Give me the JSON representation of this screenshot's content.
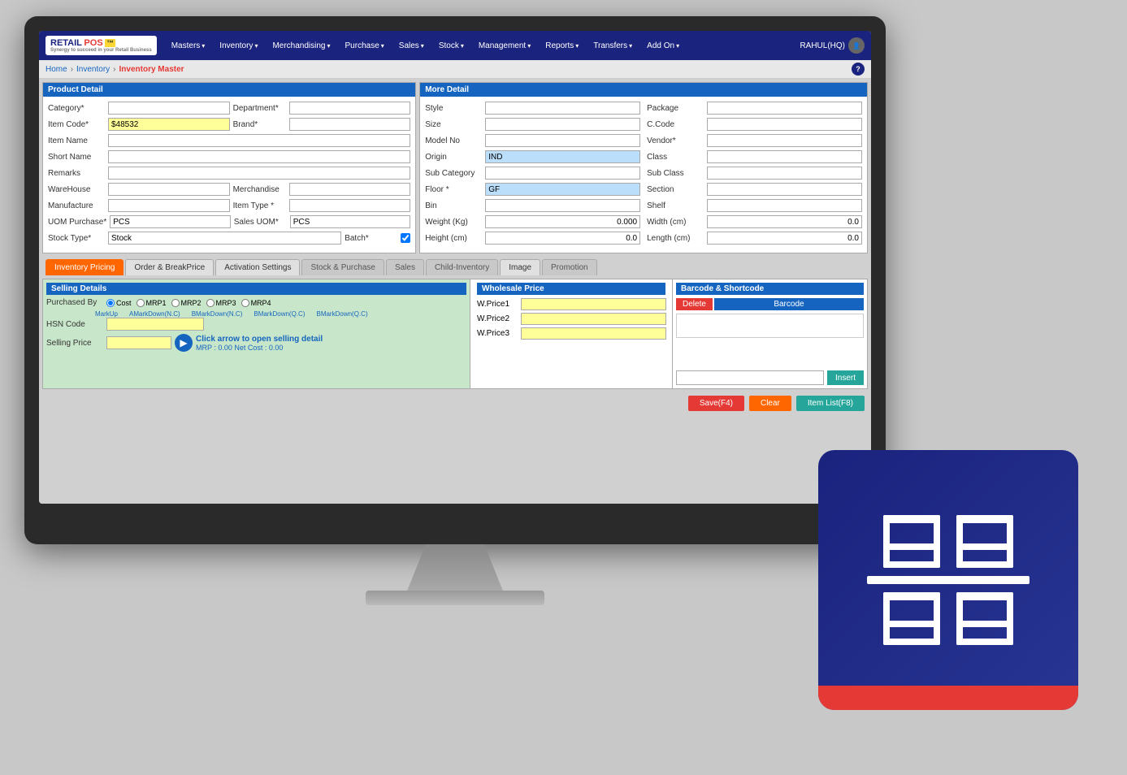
{
  "app": {
    "logo": {
      "retail": "RETAIL",
      "pos": "POS",
      "tagline": "Synergy to succeed in your Retail Business"
    },
    "user": "RAHUL(HQ)"
  },
  "nav": {
    "items": [
      {
        "label": "Masters",
        "id": "masters"
      },
      {
        "label": "Inventory",
        "id": "inventory"
      },
      {
        "label": "Merchandising",
        "id": "merchandising"
      },
      {
        "label": "Purchase",
        "id": "purchase"
      },
      {
        "label": "Sales",
        "id": "sales"
      },
      {
        "label": "Stock",
        "id": "stock"
      },
      {
        "label": "Management",
        "id": "management"
      },
      {
        "label": "Reports",
        "id": "reports"
      },
      {
        "label": "Transfers",
        "id": "transfers"
      },
      {
        "label": "Add On",
        "id": "addon"
      }
    ]
  },
  "breadcrumb": {
    "home": "Home",
    "inventory": "Inventory",
    "current": "Inventory Master"
  },
  "product_detail": {
    "title": "Product Detail",
    "fields": {
      "category_label": "Category",
      "department_label": "Department",
      "item_code_label": "Item Code",
      "item_code_value": "$48532",
      "brand_label": "Brand",
      "item_name_label": "Item Name",
      "short_name_label": "Short Name",
      "remarks_label": "Remarks",
      "warehouse_label": "WareHouse",
      "merchandise_label": "Merchandise",
      "manufacture_label": "Manufacture",
      "item_type_label": "Item Type",
      "uom_purchase_label": "UOM Purchase",
      "uom_purchase_value": "PCS",
      "sales_uom_label": "Sales UOM",
      "sales_uom_value": "PCS",
      "stock_type_label": "Stock Type",
      "stock_type_value": "Stock",
      "batch_label": "Batch"
    }
  },
  "more_detail": {
    "title": "More Detail",
    "fields": {
      "style_label": "Style",
      "package_label": "Package",
      "size_label": "Size",
      "c_code_label": "C.Code",
      "model_no_label": "Model No",
      "vendor_label": "Vendor",
      "origin_label": "Origin",
      "origin_value": "IND",
      "class_label": "Class",
      "sub_category_label": "Sub Category",
      "sub_class_label": "Sub Class",
      "floor_label": "Floor",
      "floor_value": "GF",
      "section_label": "Section",
      "bin_label": "Bin",
      "shelf_label": "Shelf",
      "weight_label": "Weight (Kg)",
      "weight_value": "0.000",
      "width_label": "Width (cm)",
      "width_value": "0.0",
      "height_label": "Height (cm)",
      "height_value": "0.0",
      "length_label": "Length (cm)",
      "length_value": "0.0"
    }
  },
  "tabs": {
    "items": [
      {
        "label": "Inventory Pricing",
        "state": "active-orange"
      },
      {
        "label": "Order & BreakPrice",
        "state": "inactive"
      },
      {
        "label": "Activation Settings",
        "state": "inactive"
      },
      {
        "label": "Stock & Purchase",
        "state": "inactive-gray"
      },
      {
        "label": "Sales",
        "state": "inactive-gray"
      },
      {
        "label": "Child-Inventory",
        "state": "inactive-gray"
      },
      {
        "label": "Image",
        "state": "inactive"
      },
      {
        "label": "Promotion",
        "state": "inactive-gray"
      }
    ]
  },
  "selling_details": {
    "title": "Selling Details",
    "purchased_by_label": "Purchased By",
    "radio_options": [
      "Cost",
      "MRP1",
      "MRP2",
      "MRP3",
      "MRP4"
    ],
    "markup_labels": [
      "MarkUp",
      "AMarkDown(N.C)",
      "BMarkDown(N.C)",
      "BMarkDown(Q.C)",
      "BMarkDown(Q.C)"
    ],
    "hsn_code_label": "HSN Code",
    "selling_price_label": "Selling Price",
    "arrow_detail_text": "Click arrow to open selling detail",
    "mrp_text": "MRP : 0.00   Net Cost : 0.00"
  },
  "wholesale_price": {
    "title": "Wholesale Price",
    "items": [
      {
        "label": "W.Price1"
      },
      {
        "label": "W.Price2"
      },
      {
        "label": "W.Price3"
      }
    ]
  },
  "barcode": {
    "title": "Barcode & Shortcode",
    "delete_label": "Delete",
    "barcode_col_label": "Barcode",
    "insert_label": "Insert"
  },
  "footer": {
    "save_label": "Save(F4)",
    "clear_label": "Clear",
    "item_list_label": "Item List(F8)"
  }
}
